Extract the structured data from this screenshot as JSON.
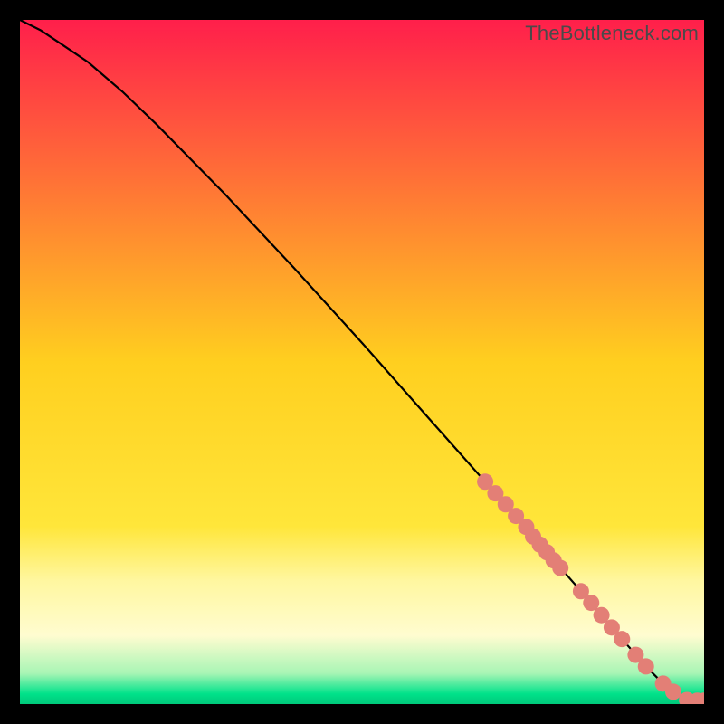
{
  "watermark": "TheBottleneck.com",
  "chart_data": {
    "type": "line",
    "title": "",
    "xlabel": "",
    "ylabel": "",
    "xlim": [
      0,
      100
    ],
    "ylim": [
      0,
      100
    ],
    "grid": false,
    "legend": false,
    "background_gradient_stops": [
      {
        "offset": 0.0,
        "color": "#ff1f4b"
      },
      {
        "offset": 0.5,
        "color": "#ffcf1f"
      },
      {
        "offset": 0.74,
        "color": "#ffe63a"
      },
      {
        "offset": 0.82,
        "color": "#fff7a0"
      },
      {
        "offset": 0.9,
        "color": "#fffcd0"
      },
      {
        "offset": 0.955,
        "color": "#a8f5b5"
      },
      {
        "offset": 0.985,
        "color": "#00e28a"
      },
      {
        "offset": 1.0,
        "color": "#00c87a"
      }
    ],
    "series": [
      {
        "name": "curve",
        "type": "line",
        "color": "#000000",
        "x": [
          0,
          3,
          6,
          10,
          15,
          20,
          30,
          40,
          50,
          60,
          68,
          75,
          82,
          88,
          92,
          94,
          95.5,
          97.5,
          99,
          100
        ],
        "y": [
          100,
          98.5,
          96.5,
          93.8,
          89.5,
          84.7,
          74.5,
          63.8,
          52.8,
          41.5,
          32.5,
          24.5,
          16.5,
          9.5,
          5.0,
          3.0,
          1.8,
          0.6,
          0.5,
          0.5
        ]
      },
      {
        "name": "points",
        "type": "scatter",
        "color": "#e37f76",
        "radius": 9,
        "x": [
          68,
          69.5,
          71,
          72.5,
          74,
          75,
          76,
          77,
          78,
          79,
          82,
          83.5,
          85,
          86.5,
          88,
          90,
          91.5,
          94,
          95.5,
          97.5,
          99,
          100
        ],
        "y": [
          32.5,
          30.8,
          29.2,
          27.5,
          25.9,
          24.5,
          23.3,
          22.2,
          21.0,
          19.9,
          16.5,
          14.8,
          13.0,
          11.2,
          9.5,
          7.2,
          5.5,
          3.0,
          1.8,
          0.6,
          0.5,
          0.5
        ]
      }
    ]
  }
}
